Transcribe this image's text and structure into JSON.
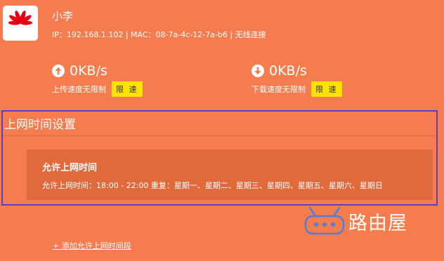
{
  "device": {
    "name": "小李",
    "info": "IP：192.168.1.102 | MAC：08-7a-4c-12-7a-b6 | 无线连接",
    "logo": "huawei-logo"
  },
  "upload": {
    "value": "0KB/s",
    "label": "上传速度无限制",
    "limit_button": "限 速"
  },
  "download": {
    "value": "0KB/s",
    "label": "下载速度无限制",
    "limit_button": "限 速"
  },
  "section": {
    "title": "上网时间设置"
  },
  "rule": {
    "title": "允许上网时间",
    "detail": "允许上网时间：18:00 - 22:00   重复：星期一、星期二、星期三、星期四、星期五、星期六、星期日"
  },
  "add_link": "+ 添加允许上网时间段",
  "watermark": {
    "text": "路由屋"
  },
  "colors": {
    "background": "#F47C4E",
    "card": "#E06A3C",
    "limit_button": "#FFE300",
    "selection_border": "#5A3FC0"
  }
}
